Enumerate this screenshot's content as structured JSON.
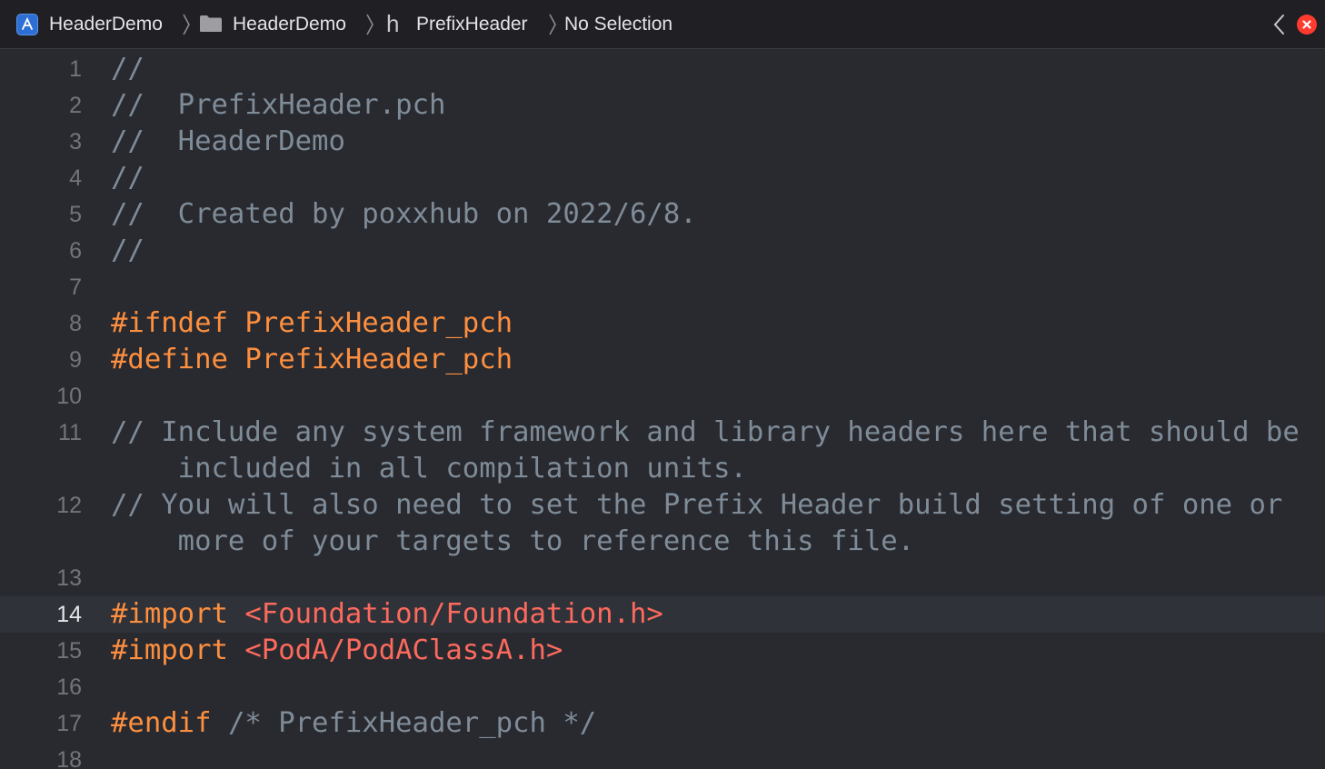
{
  "jumpbar": {
    "crumbs": [
      "HeaderDemo",
      "HeaderDemo",
      "PrefixHeader",
      "No Selection"
    ],
    "file_type_glyph": "h",
    "icons": {
      "project": "xcode-app-icon",
      "group": "folder-icon",
      "file": "header-file-icon",
      "back": "chevron-left-icon",
      "issue": "error-icon"
    }
  },
  "editor": {
    "current_line": 14,
    "lines": [
      {
        "n": "1",
        "tokens": [
          {
            "t": "//",
            "k": "comment"
          }
        ]
      },
      {
        "n": "2",
        "tokens": [
          {
            "t": "//  PrefixHeader.pch",
            "k": "comment"
          }
        ]
      },
      {
        "n": "3",
        "tokens": [
          {
            "t": "//  HeaderDemo",
            "k": "comment"
          }
        ]
      },
      {
        "n": "4",
        "tokens": [
          {
            "t": "//",
            "k": "comment"
          }
        ]
      },
      {
        "n": "5",
        "tokens": [
          {
            "t": "//  Created by poxxhub on 2022/6/8.",
            "k": "comment"
          }
        ]
      },
      {
        "n": "6",
        "tokens": [
          {
            "t": "//",
            "k": "comment"
          }
        ]
      },
      {
        "n": "7",
        "tokens": []
      },
      {
        "n": "8",
        "tokens": [
          {
            "t": "#ifndef PrefixHeader_pch",
            "k": "pre"
          }
        ]
      },
      {
        "n": "9",
        "tokens": [
          {
            "t": "#define PrefixHeader_pch",
            "k": "pre"
          }
        ]
      },
      {
        "n": "10",
        "tokens": []
      },
      {
        "n": "11",
        "tokens": [
          {
            "t": "// Include any system framework and library headers here that should be",
            "k": "comment"
          }
        ]
      },
      {
        "n": "",
        "tokens": [
          {
            "t": "    included in all compilation units.",
            "k": "comment"
          }
        ]
      },
      {
        "n": "12",
        "tokens": [
          {
            "t": "// You will also need to set the Prefix Header build setting of one or",
            "k": "comment"
          }
        ]
      },
      {
        "n": "",
        "tokens": [
          {
            "t": "    more of your targets to reference this file.",
            "k": "comment"
          }
        ]
      },
      {
        "n": "13",
        "tokens": []
      },
      {
        "n": "14",
        "tokens": [
          {
            "t": "#import ",
            "k": "pre"
          },
          {
            "t": "<Foundation/Foundation.h>",
            "k": "str"
          }
        ]
      },
      {
        "n": "15",
        "tokens": [
          {
            "t": "#import ",
            "k": "pre"
          },
          {
            "t": "<PodA/PodAClassA.h>",
            "k": "str"
          }
        ]
      },
      {
        "n": "16",
        "tokens": []
      },
      {
        "n": "17",
        "tokens": [
          {
            "t": "#endif ",
            "k": "pre"
          },
          {
            "t": "/* PrefixHeader_pch */",
            "k": "comment"
          }
        ]
      },
      {
        "n": "18",
        "tokens": []
      }
    ]
  },
  "colors": {
    "background": "#292a30",
    "comment": "#7f8c98",
    "preprocessor": "#fd8f3f",
    "string": "#fc6a5d",
    "line_number": "#747478",
    "current_line_highlight": "#2f3239"
  }
}
